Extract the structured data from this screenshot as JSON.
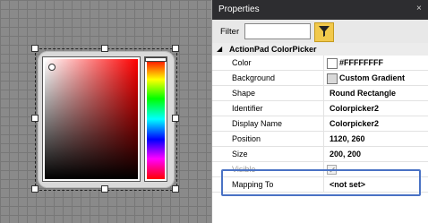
{
  "canvas": {
    "widget_name": "ActionPad ColorPicker"
  },
  "panel": {
    "title": "Properties",
    "close_glyph": "×",
    "filter_label": "Filter",
    "filter_value": "",
    "filter_button_icon": "filter-icon",
    "section_title": "ActionPad ColorPicker",
    "section_arrow": "◢",
    "accent_color": "#4a72c4"
  },
  "properties": [
    {
      "name": "Color",
      "value": "#FFFFFFFF",
      "swatch": "#ffffff"
    },
    {
      "name": "Background",
      "value": "Custom Gradient",
      "swatch": "#d9d9d9"
    },
    {
      "name": "Shape",
      "value": "Round Rectangle"
    },
    {
      "name": "Identifier",
      "value": "Colorpicker2"
    },
    {
      "name": "Display Name",
      "value": "Colorpicker2"
    },
    {
      "name": "Position",
      "value": "1120, 260"
    },
    {
      "name": "Size",
      "value": "200, 200"
    },
    {
      "name": "Visible",
      "value": "",
      "checked": true
    },
    {
      "name": "Mapping To",
      "value": "<not set>"
    }
  ]
}
